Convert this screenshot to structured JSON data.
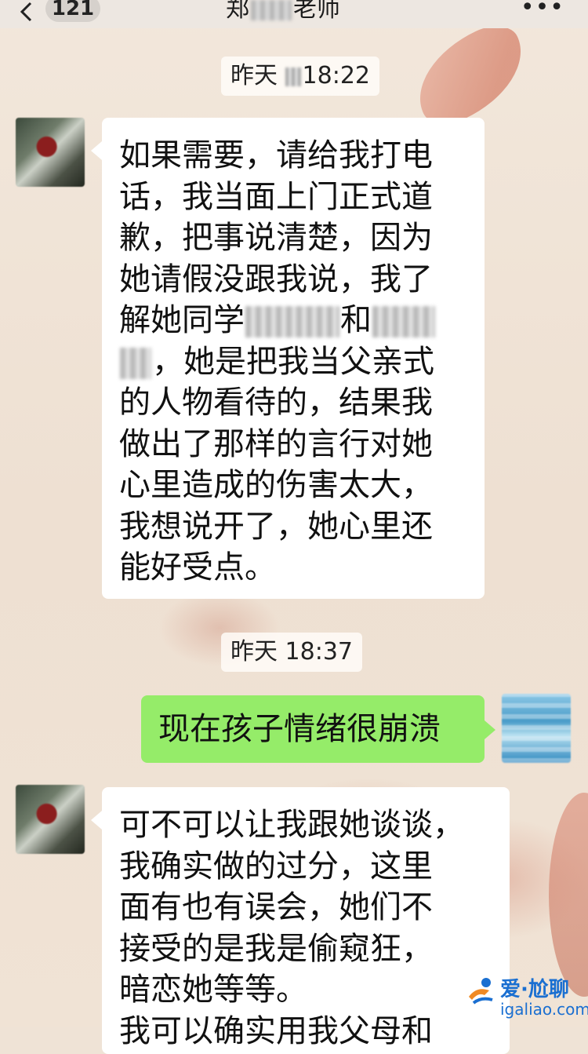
{
  "header": {
    "unread_count": "121",
    "title_prefix": "郑",
    "title_suffix": "老师",
    "more_glyph": "•••"
  },
  "messages": [
    {
      "time": "昨天 18:22",
      "time_prefix": "昨天",
      "time_value": "18:22",
      "from": "teacher",
      "lines": [
        "如果需要，请给我打电",
        "话，我当面上门正式道",
        "歉，把事说清楚，因为",
        "她请假没跟我说，我了"
      ],
      "redacted_line_a_prefix": "解她同学",
      "redacted_line_a_mid": "和",
      "redacted_line_b_suffix": "，她是把我当父亲式",
      "lines_after": [
        "的人物看待的，结果我",
        "做出了那样的言行对她",
        "心里造成的伤害太大，",
        "我想说开了，她心里还",
        "能好受点。"
      ]
    },
    {
      "time": "昨天 18:37",
      "from": "me",
      "text": "现在孩子情绪很崩溃"
    },
    {
      "from": "teacher",
      "lines": [
        "可不可以让我跟她谈谈，",
        "我确实做的过分，这里",
        "面有也有误会，她们不",
        "接受的是我是偷窥狂，",
        "暗恋她等等。",
        "我可以确实用我父母和"
      ]
    }
  ],
  "watermark": {
    "text": "爱·尬聊",
    "url": "igaliao.com"
  },
  "colors": {
    "my_bubble": "#95ec69",
    "their_bubble": "#ffffff",
    "background": "#efe3d6"
  }
}
